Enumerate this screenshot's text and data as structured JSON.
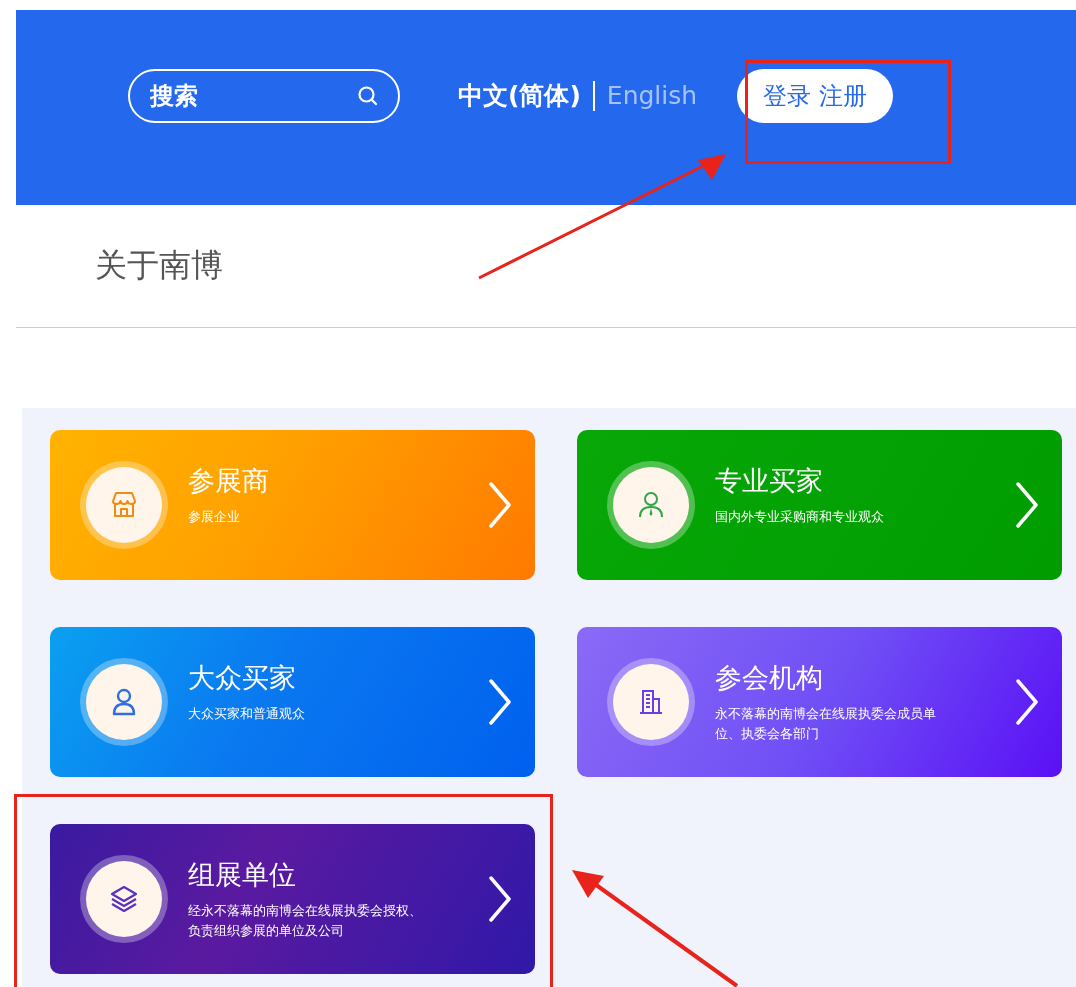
{
  "header": {
    "search": {
      "placeholder": "搜索"
    },
    "languages": [
      {
        "label": "中文(简体)",
        "selected": true
      },
      {
        "label": "English",
        "selected": false
      }
    ],
    "auth_button": "登录 注册"
  },
  "nav": {
    "title": "关于南博"
  },
  "cards": [
    {
      "kind": "exhibitor",
      "title": "参展商",
      "subtitle": "参展企业"
    },
    {
      "kind": "professional",
      "title": "专业买家",
      "subtitle": "国内外专业采购商和专业观众"
    },
    {
      "kind": "public",
      "title": "大众买家",
      "subtitle": "大众买家和普通观众"
    },
    {
      "kind": "institution",
      "title": "参会机构",
      "subtitle": "永不落幕的南博会在线展执委会成员单位、执委会各部门"
    },
    {
      "kind": "organizer",
      "title": "组展单位",
      "subtitle": "经永不落幕的南博会在线展执委会授权、负责组织参展的单位及公司"
    }
  ]
}
